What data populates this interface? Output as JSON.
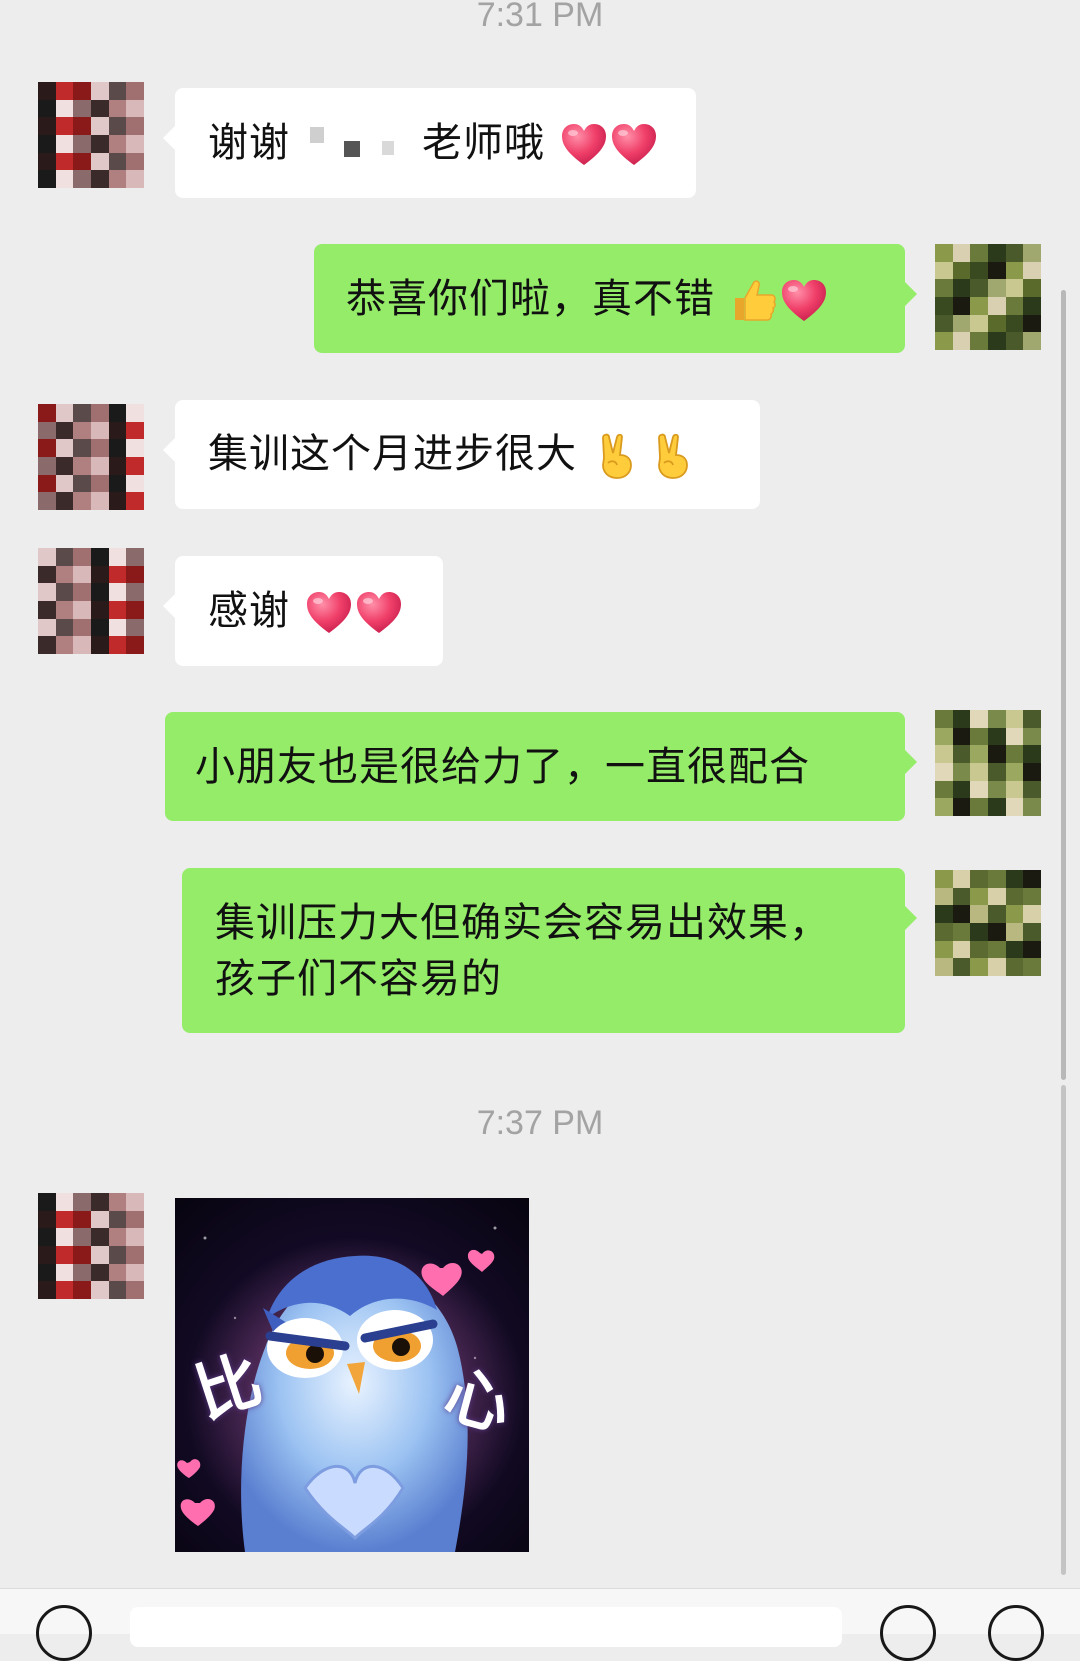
{
  "timestamps": [
    "7:31 PM",
    "7:37 PM"
  ],
  "messages": [
    {
      "side": "left",
      "text": "谢谢",
      "text_after": "老师哦",
      "emojis": [
        "heart-icon",
        "heart-icon"
      ]
    },
    {
      "side": "right",
      "text": "恭喜你们啦，真不错",
      "emojis": [
        "thumbs-up-icon",
        "heart-icon"
      ]
    },
    {
      "side": "left",
      "text": "集训这个月进步很大",
      "emojis": [
        "victory-hand-icon",
        "victory-hand-icon"
      ]
    },
    {
      "side": "left",
      "text": "感谢",
      "emojis": [
        "heart-icon",
        "heart-icon"
      ]
    },
    {
      "side": "right",
      "text": "小朋友也是很给力了，一直很配合"
    },
    {
      "side": "right",
      "line1": "集训压力大但确实会容易出效果，",
      "line2": "孩子们不容易的"
    }
  ],
  "sticker": {
    "caption_left": "比",
    "caption_right": "心",
    "icon": "owl-heart-sticker"
  },
  "colors": {
    "background": "#ededed",
    "sent_bubble": "#95ec69",
    "received_bubble": "#ffffff",
    "timestamp": "#a3a3a3",
    "heart": "#f0406a"
  }
}
